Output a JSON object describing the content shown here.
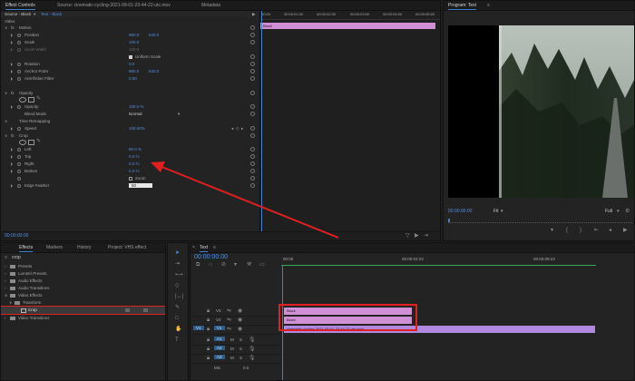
{
  "effect_controls": {
    "tabs": [
      "Effect Controls",
      "Source: cinematic-cycling-2021-09-01-23-44-22-utc.mov",
      "Metadata"
    ],
    "source_selector": "Source - Black",
    "clip_selector": "Text - Black",
    "timeline_times": [
      "00:00",
      "00:00:01:00",
      "00:00:02:00",
      "00:00:03:00",
      "00:00:04:00",
      "00:00:05:00"
    ],
    "clip_bar_label": "Black",
    "section_video": "Video",
    "motion": {
      "name": "Motion",
      "position": "Position",
      "position_x": "960.0",
      "position_y": "540.0",
      "scale": "Scale",
      "scale_val": "100.0",
      "scale_width": "Scale Width",
      "scale_width_val": "100.0",
      "uniform_scale": "Uniform Scale",
      "rotation": "Rotation",
      "rotation_val": "0.0",
      "anchor": "Anchor Point",
      "anchor_x": "960.0",
      "anchor_y": "540.0",
      "antiflicker": "Anti-flicker Filter",
      "antiflicker_val": "0.00"
    },
    "opacity": {
      "name": "Opacity",
      "opacity": "Opacity",
      "opacity_val": "100.0 %",
      "blend": "Blend Mode",
      "blend_val": "Normal"
    },
    "time_remap": {
      "name": "Time Remapping",
      "speed": "Speed",
      "speed_val": "100.00%"
    },
    "crop": {
      "name": "Crop",
      "left": "Left",
      "left_val": "80.0 %",
      "top": "Top",
      "top_val": "0.0 %",
      "right": "Right",
      "right_val": "0.0 %",
      "bottom": "Bottom",
      "bottom_val": "0.0 %",
      "zoom": "Zoom",
      "edge": "Edge Feather",
      "edge_val": "50"
    },
    "timecode": "00:00:00:00"
  },
  "program_monitor": {
    "title": "Program: Text",
    "timecode": "00:00:00:00",
    "fit": "Fit",
    "zoom_ratio": "Full"
  },
  "effects_panel": {
    "tabs": [
      "Effects",
      "Markers",
      "History",
      "Project: VHS effect"
    ],
    "search_value": "crop",
    "tree": [
      {
        "label": "Presets",
        "indent": 0
      },
      {
        "label": "Lumetri Presets",
        "indent": 0
      },
      {
        "label": "Audio Effects",
        "indent": 0
      },
      {
        "label": "Audio Transitions",
        "indent": 0
      },
      {
        "label": "Video Effects",
        "indent": 0
      },
      {
        "label": "Transform",
        "indent": 1
      },
      {
        "label": "Crop",
        "indent": 2
      },
      {
        "label": "Video Transitions",
        "indent": 0
      }
    ]
  },
  "timeline": {
    "title": "Text",
    "timecode": "00:00:00:00",
    "ruler": [
      "00:00",
      "00:00:04:23",
      "00:00:09:23"
    ],
    "video_tracks": [
      "V3",
      "V2",
      "V1"
    ],
    "audio_tracks": [
      "A1",
      "A2",
      "A3"
    ],
    "source_patch": "V1",
    "clips": {
      "v3": "Black",
      "v2": "Black",
      "v1": "cinematic-cycling-2021-09-01-23-44-22-utc.mov"
    },
    "mix": "Mix",
    "mix_val": "0.0"
  },
  "colors": {
    "accent_blue": "#4f8fe3",
    "clip_pink": "#d18fd6",
    "clip_violet": "#b188e0",
    "highlight_red": "#e02020"
  }
}
